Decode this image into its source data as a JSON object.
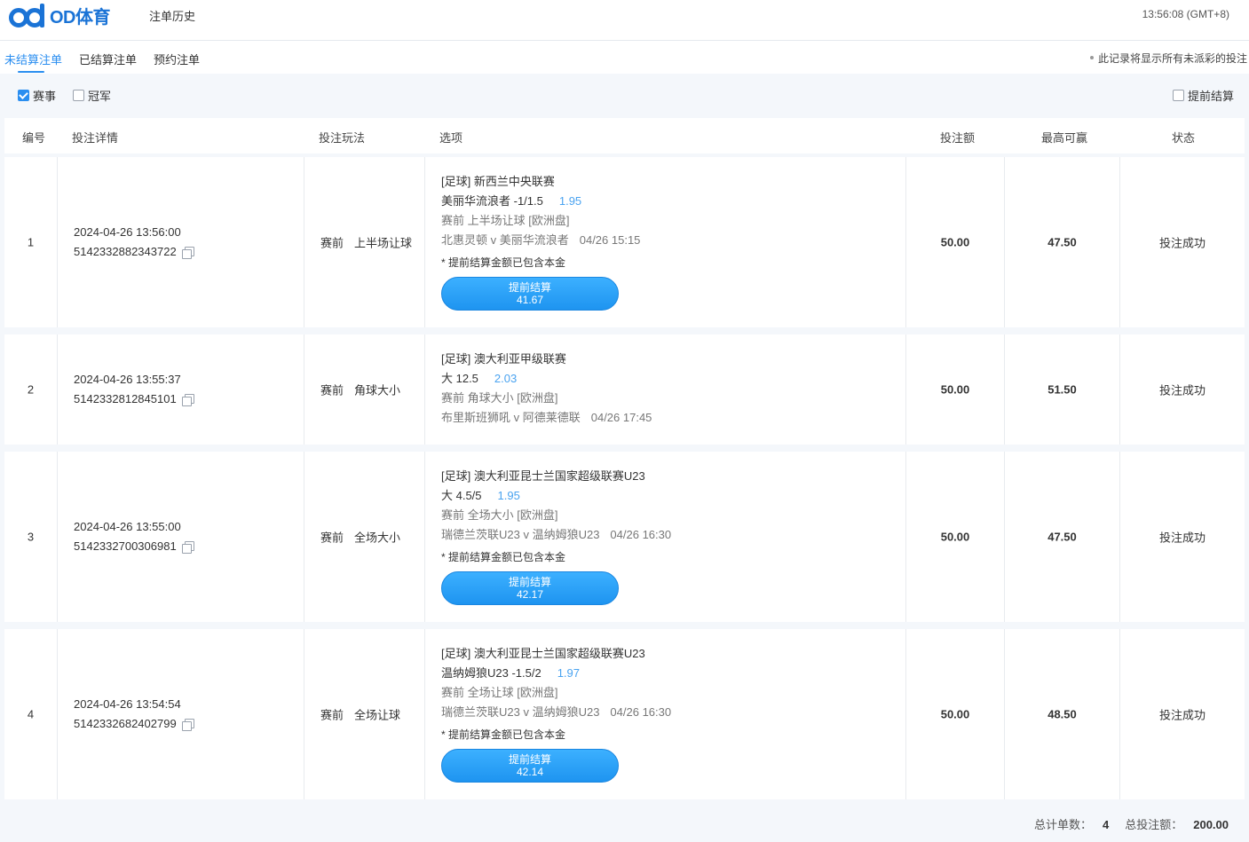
{
  "header": {
    "logo_text": "OD体育",
    "title": "注单历史",
    "time": "13:56:08 (GMT+8)"
  },
  "tabs": [
    {
      "label": "未结算注单",
      "active": true
    },
    {
      "label": "已结算注单",
      "active": false
    },
    {
      "label": "预约注单",
      "active": false
    }
  ],
  "tabs_note": "此记录将显示所有未派彩的投注",
  "filters": {
    "match": {
      "label": "赛事",
      "checked": true
    },
    "champion": {
      "label": "冠军",
      "checked": false
    },
    "early_settle": {
      "label": "提前结算",
      "checked": false
    }
  },
  "table": {
    "headers": {
      "num": "编号",
      "detail": "投注详情",
      "play": "投注玩法",
      "option": "选项",
      "stake": "投注额",
      "max_win": "最高可赢",
      "status": "状态"
    },
    "rows": [
      {
        "num": "1",
        "time": "2024-04-26 13:56:00",
        "order_id": "5142332882343722",
        "play_a": "赛前",
        "play_b": "上半场让球",
        "league": "[足球] 新西兰中央联赛",
        "pick": "美丽华流浪者 -1/1.5",
        "odds": "1.95",
        "market": "赛前  上半场让球 [欧洲盘]",
        "teams": "北惠灵顿 v 美丽华流浪者",
        "match_time": "04/26 15:15",
        "note": "* 提前结算金额已包含本金",
        "settle_label": "提前结算",
        "settle_value": "41.67",
        "stake": "50.00",
        "max_win": "47.50",
        "status": "投注成功"
      },
      {
        "num": "2",
        "time": "2024-04-26 13:55:37",
        "order_id": "5142332812845101",
        "play_a": "赛前",
        "play_b": "角球大小",
        "league": "[足球] 澳大利亚甲级联赛",
        "pick": "大 12.5",
        "odds": "2.03",
        "market": "赛前  角球大小 [欧洲盘]",
        "teams": "布里斯班狮吼 v 阿德莱德联",
        "match_time": "04/26 17:45",
        "note": "",
        "settle_label": "",
        "settle_value": "",
        "stake": "50.00",
        "max_win": "51.50",
        "status": "投注成功"
      },
      {
        "num": "3",
        "time": "2024-04-26 13:55:00",
        "order_id": "5142332700306981",
        "play_a": "赛前",
        "play_b": "全场大小",
        "league": "[足球] 澳大利亚昆士兰国家超级联赛U23",
        "pick": "大 4.5/5",
        "odds": "1.95",
        "market": "赛前  全场大小 [欧洲盘]",
        "teams": "瑞德兰茨联U23 v 温纳姆狼U23",
        "match_time": "04/26 16:30",
        "note": "* 提前结算金额已包含本金",
        "settle_label": "提前结算",
        "settle_value": "42.17",
        "stake": "50.00",
        "max_win": "47.50",
        "status": "投注成功"
      },
      {
        "num": "4",
        "time": "2024-04-26 13:54:54",
        "order_id": "5142332682402799",
        "play_a": "赛前",
        "play_b": "全场让球",
        "league": "[足球] 澳大利亚昆士兰国家超级联赛U23",
        "pick": "温纳姆狼U23 -1.5/2",
        "odds": "1.97",
        "market": "赛前  全场让球 [欧洲盘]",
        "teams": "瑞德兰茨联U23 v 温纳姆狼U23",
        "match_time": "04/26 16:30",
        "note": "* 提前结算金额已包含本金",
        "settle_label": "提前结算",
        "settle_value": "42.14",
        "stake": "50.00",
        "max_win": "48.50",
        "status": "投注成功"
      }
    ]
  },
  "footer": {
    "count_label": "总计单数：",
    "count": "4",
    "total_label": "总投注额：",
    "total": "200.00"
  },
  "colors": {
    "accent": "#2a8ef0",
    "logo": "#1a73d6",
    "odds": "#4aa3f0",
    "button": "#1e94f0"
  }
}
